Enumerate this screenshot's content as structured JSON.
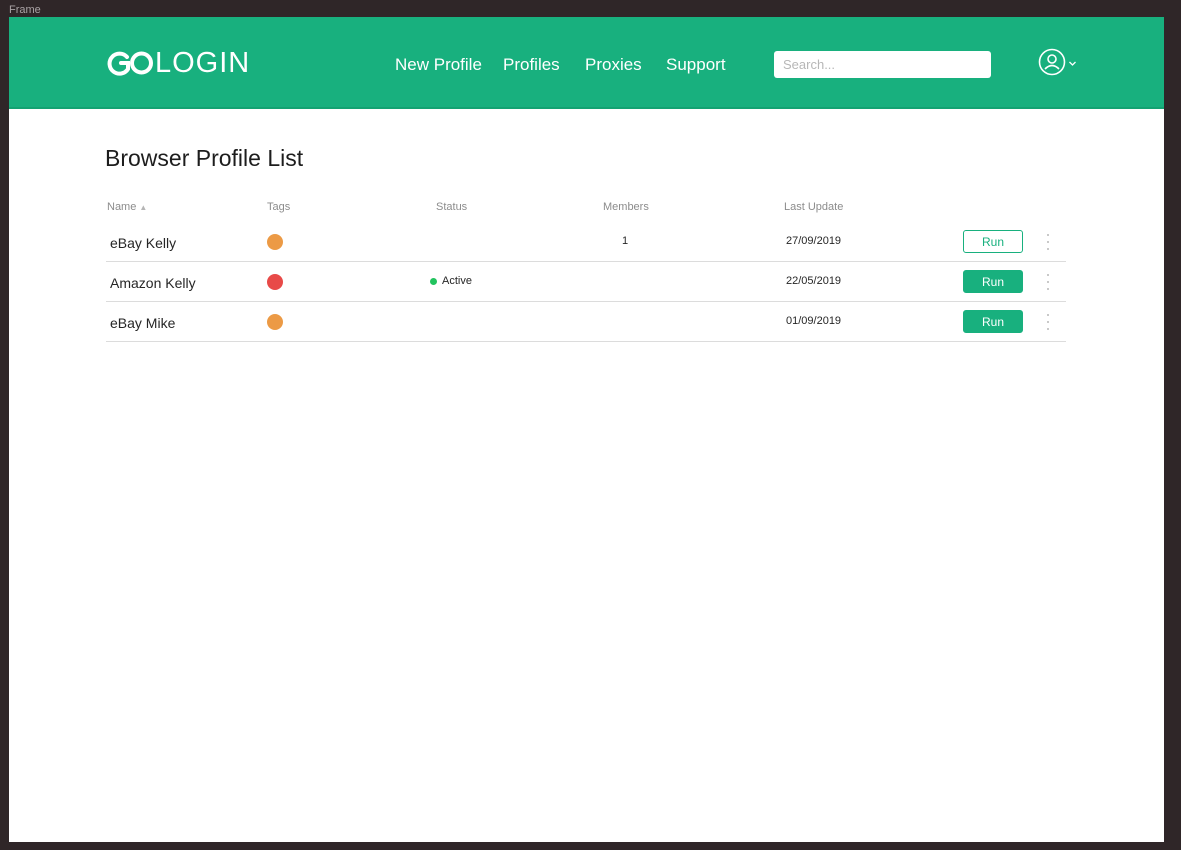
{
  "frame_label": "Frame",
  "brand": {
    "logo_text": "LOGIN",
    "accent": "#18b07e"
  },
  "nav": {
    "items": [
      {
        "label": "New Profile"
      },
      {
        "label": "Profiles"
      },
      {
        "label": "Proxies"
      },
      {
        "label": "Support"
      }
    ]
  },
  "search": {
    "placeholder": "Search...",
    "value": ""
  },
  "account": {
    "icon": "user-circle-icon",
    "caret_icon": "chevron-down-icon"
  },
  "page": {
    "title": "Browser Profile List"
  },
  "table": {
    "columns": {
      "name": "Name",
      "tags": "Tags",
      "status": "Status",
      "members": "Members",
      "last_update": "Last Update"
    },
    "sort_indicator": "▲",
    "rows": [
      {
        "name": "eBay Kelly",
        "tag_color": "#ec9a45",
        "status": "",
        "status_color": "",
        "members": "1",
        "last_update": "27/09/2019",
        "run_label": "Run",
        "run_style": "outline"
      },
      {
        "name": "Amazon Kelly",
        "tag_color": "#e84a48",
        "status": "Active",
        "status_color": "#22c35e",
        "members": "",
        "last_update": "22/05/2019",
        "run_label": "Run",
        "run_style": "solid"
      },
      {
        "name": "eBay Mike",
        "tag_color": "#ec9a45",
        "status": "",
        "status_color": "",
        "members": "",
        "last_update": "01/09/2019",
        "run_label": "Run",
        "run_style": "solid"
      }
    ]
  }
}
